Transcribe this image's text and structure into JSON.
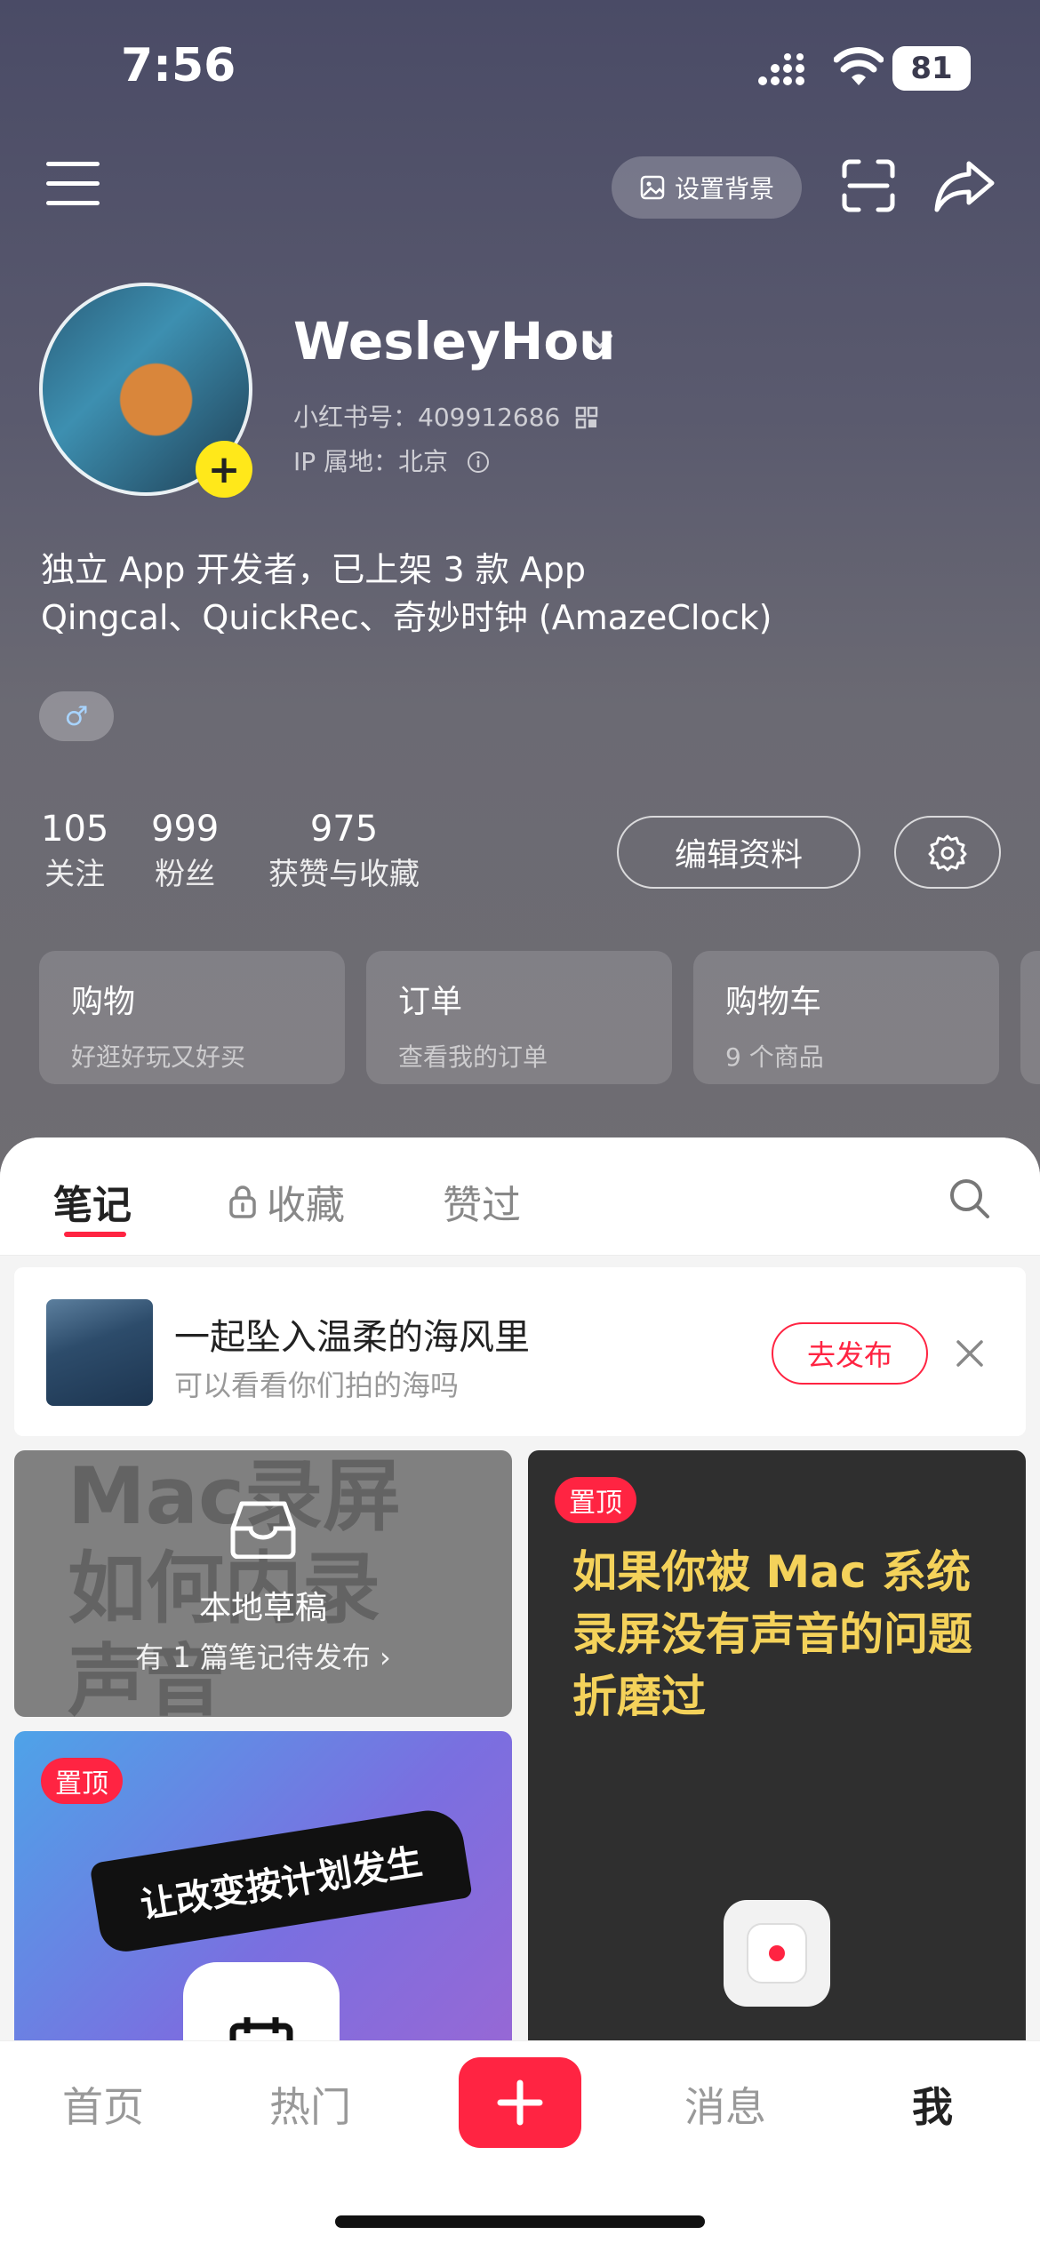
{
  "status_bar": {
    "time": "7:56",
    "battery": "81"
  },
  "top_nav": {
    "set_background_label": "设置背景"
  },
  "profile": {
    "username": "WesleyHou",
    "red_id": "小红书号：409912686",
    "ip_location": "IP 属地：北京",
    "bio_line1": "独立 App 开发者，已上架 3 款 App",
    "bio_line2": "Qingcal、QuickRec、奇妙时钟 (AmazeClock)",
    "gender_symbol": "♂",
    "stats": [
      {
        "value": "105",
        "label": "关注"
      },
      {
        "value": "999",
        "label": "粉丝"
      },
      {
        "value": "975",
        "label": "获赞与收藏"
      }
    ],
    "edit_label": "编辑资料"
  },
  "quick_cards": [
    {
      "title": "购物",
      "subtitle": "好逛好玩又好买"
    },
    {
      "title": "订单",
      "subtitle": "查看我的订单"
    },
    {
      "title": "购物车",
      "subtitle": "9 个商品"
    }
  ],
  "content_tabs": {
    "notes": "笔记",
    "collections": "收藏",
    "liked": "赞过"
  },
  "banner": {
    "title": "一起坠入温柔的海风里",
    "subtitle": "可以看看你们拍的海吗",
    "publish_label": "去发布"
  },
  "draft_card": {
    "bg_text_line1": "Mac录屏",
    "bg_text_line2": "如何内录",
    "bg_text_line3": "声音",
    "title": "本地草稿",
    "subtitle": "有 1 篇笔记待发布 ›"
  },
  "note_a": {
    "pin_label": "置顶",
    "brush_text": "让改变按计划发生"
  },
  "note_b": {
    "pin_label": "置顶",
    "line1": "如果你被 Mac 系统",
    "line2": "录屏没有声音的问题",
    "line3": "折磨过"
  },
  "tabbar": {
    "home": "首页",
    "hot": "热门",
    "messages": "消息",
    "me": "我"
  },
  "colors": {
    "accent": "#ff2442",
    "hero_top": "#4a4b66",
    "hero_bottom": "#6f6d72"
  }
}
